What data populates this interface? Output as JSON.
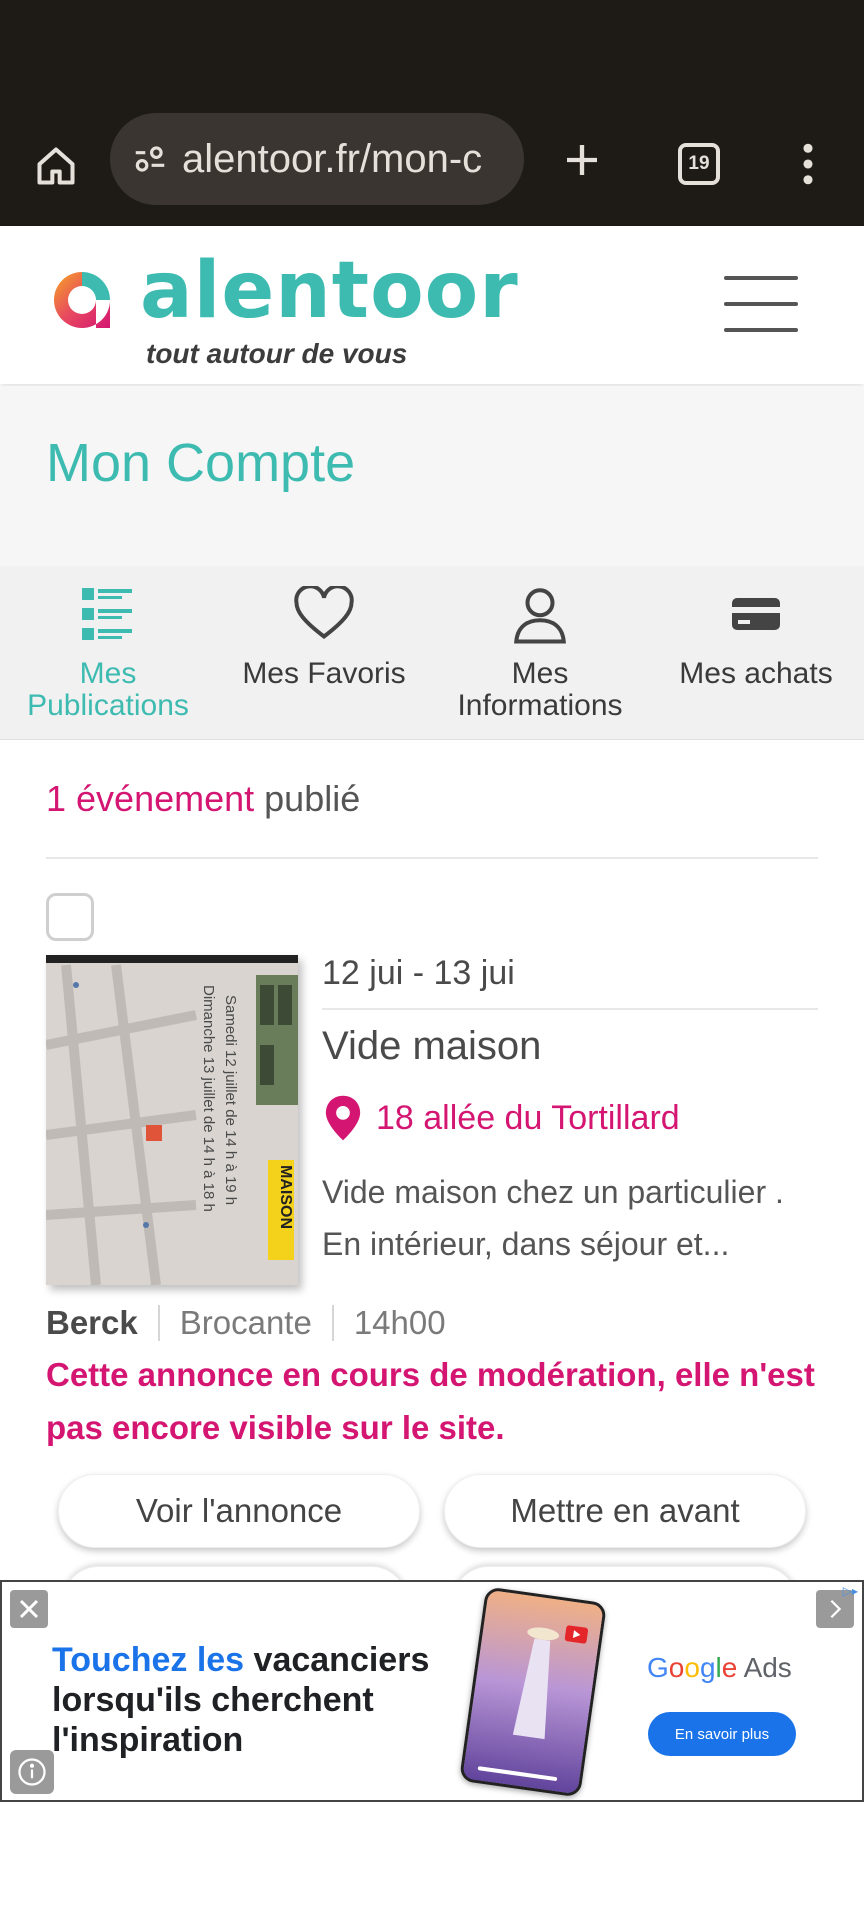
{
  "browser": {
    "url": "alentoor.fr/mon-c",
    "tab_count": "19"
  },
  "site": {
    "logo_word": "alentoor",
    "logo_tagline": "tout autour de vous"
  },
  "page": {
    "title": "Mon Compte"
  },
  "tabs": [
    {
      "label": "Mes Publications",
      "icon": "list-icon",
      "active": true
    },
    {
      "label": "Mes Favoris",
      "icon": "heart-icon",
      "active": false
    },
    {
      "label": "Mes Informations",
      "icon": "user-icon",
      "active": false
    },
    {
      "label": "Mes achats",
      "icon": "card-icon",
      "active": false
    }
  ],
  "summary": {
    "count_accent": "1 événement",
    "count_rest": " publié"
  },
  "event": {
    "dates": "12 jui - 13 jui",
    "title": "Vide maison",
    "address": "18 allée du Tortillard",
    "description": "Vide maison chez un particulier . En intérieur, dans séjour et...",
    "city": "Berck",
    "category": "Brocante",
    "time": "14h00",
    "moderation": "Cette annonce en cours de modération, elle n'est pas encore visible sur le site.",
    "thumb_line1": "Samedi 12 juillet de 14 h à 19 h",
    "thumb_line2": "Dimanche 13 juillet de 14 h à 18 h",
    "thumb_label": "MAISON"
  },
  "actions": {
    "view": "Voir l'annonce",
    "promote": "Mettre en avant"
  },
  "ad": {
    "headline_blue": "Touchez les",
    "headline_rest": " vacanciers lorsqu'ils cherchent l'inspiration",
    "brand_ads": " Ads",
    "cta": "En savoir plus"
  },
  "colors": {
    "accent_teal": "#3dbbb0",
    "accent_pink": "#d41672",
    "chrome_dark": "#1e1a16"
  }
}
